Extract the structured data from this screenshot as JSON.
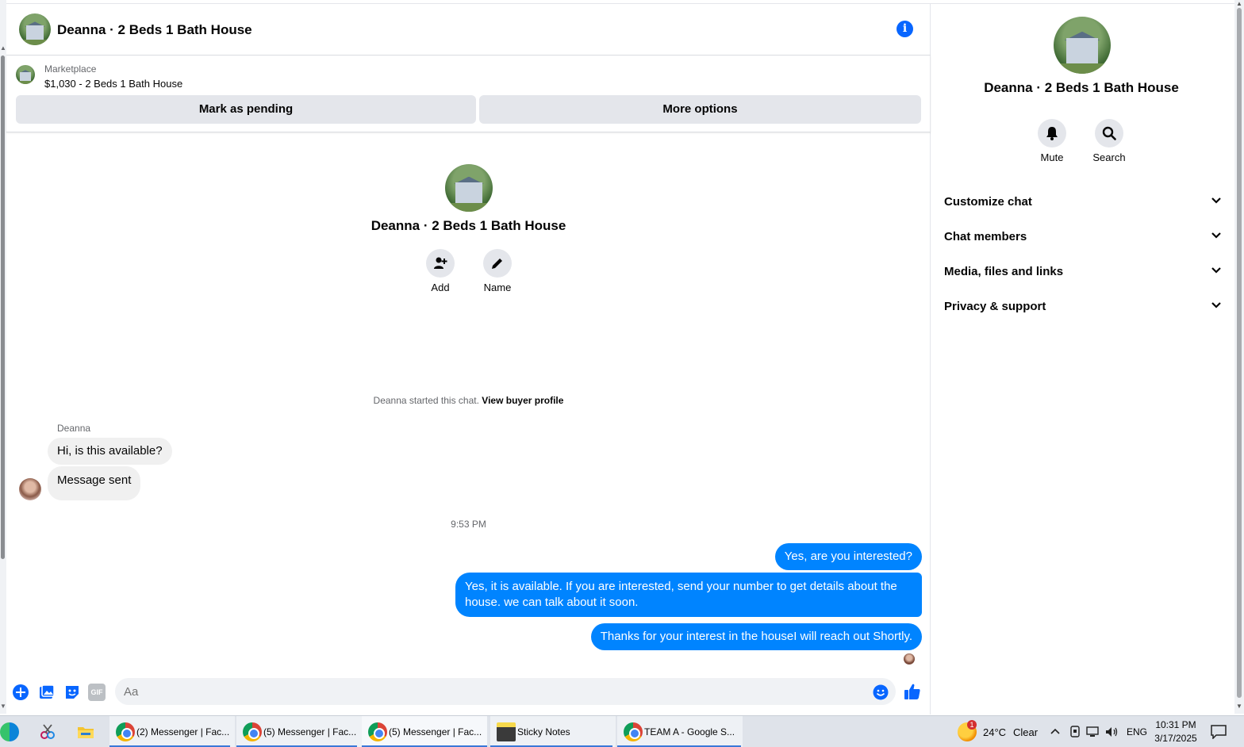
{
  "conversation": {
    "title": "Deanna · 2 Beds 1 Bath House"
  },
  "marketplace": {
    "label": "Marketplace",
    "listing": "$1,030 - 2 Beds 1 Bath House",
    "mark_pending": "Mark as pending",
    "more_options": "More options"
  },
  "intro": {
    "title": "Deanna · 2 Beds 1 Bath House",
    "add_label": "Add",
    "name_label": "Name",
    "started_text": "Deanna started this chat.",
    "view_profile": "View buyer profile"
  },
  "messages": {
    "sender": "Deanna",
    "incoming": [
      "Hi, is this available?",
      "Message sent"
    ],
    "timestamp": "9:53 PM",
    "outgoing": [
      "Yes, are you interested?",
      "Yes, it is available. If you are interested, send your number to get details about the house. we can talk about it soon.",
      "Thanks for your interest in the houseI will reach out Shortly."
    ]
  },
  "composer": {
    "placeholder": "Aa",
    "gif_label": "GIF"
  },
  "sidebar": {
    "title": "Deanna · 2 Beds 1 Bath House",
    "mute_label": "Mute",
    "search_label": "Search",
    "sections": [
      "Customize chat",
      "Chat members",
      "Media, files and links",
      "Privacy & support"
    ]
  },
  "taskbar": {
    "apps": [
      "(2) Messenger | Fac...",
      "(5) Messenger | Fac...",
      "(5) Messenger | Fac...",
      "Sticky Notes",
      "TEAM A - Google S..."
    ],
    "weather": "24°C",
    "weather_desc": "Clear",
    "notification_count": "1",
    "language": "ENG",
    "time": "10:31 PM",
    "date": "3/17/2025"
  },
  "colors": {
    "accent": "#0866ff",
    "bubble_out": "#0084ff",
    "bubble_in": "#f0f0f0"
  }
}
